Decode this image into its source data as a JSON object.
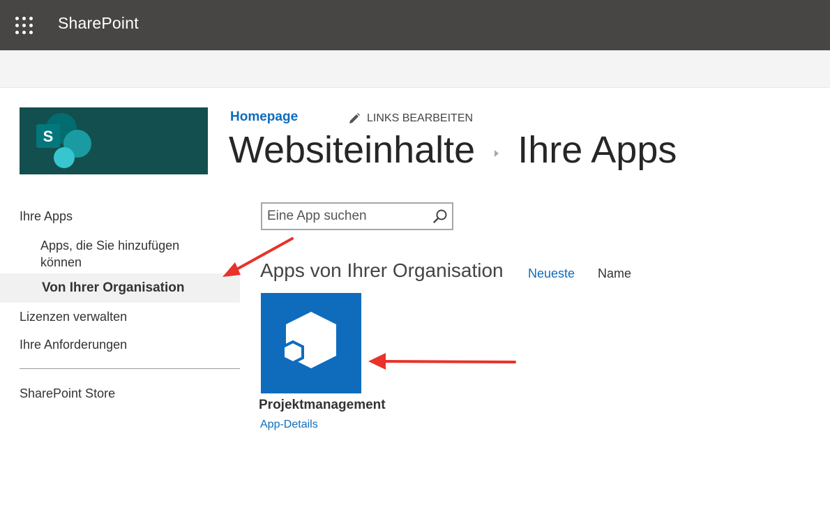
{
  "suitebar": {
    "app_title": "SharePoint",
    "launcher_icon": "app-launcher-icon",
    "background": "#484644"
  },
  "site": {
    "logo_letter": "S",
    "logo_icon": "sharepoint-logo-icon",
    "logo_background": "#134f4e"
  },
  "header": {
    "homepage_link": "Homepage",
    "edit_links_label": "LINKS BEARBEITEN",
    "edit_icon": "pencil-icon",
    "breadcrumb": [
      "Websiteinhalte",
      "Ihre Apps"
    ]
  },
  "leftnav": {
    "items": [
      {
        "label": "Ihre Apps"
      },
      {
        "label_line1": "Apps, die Sie hinzufügen",
        "label_line2": "können"
      },
      {
        "label": "Von Ihrer Organisation",
        "selected": true
      },
      {
        "label": "Lizenzen verwalten"
      },
      {
        "label": "Ihre Anforderungen"
      },
      {
        "label": "SharePoint Store"
      }
    ]
  },
  "search": {
    "placeholder": "Eine App suchen",
    "value": "",
    "icon": "search-icon"
  },
  "main": {
    "section_heading": "Apps von Ihrer Organisation",
    "sort_options": [
      {
        "label": "Neueste",
        "active": true
      },
      {
        "label": "Name",
        "active": false
      }
    ],
    "apps": [
      {
        "name": "Projektmanagement",
        "details_link": "App-Details",
        "icon": "app-cubes-icon",
        "tile_color": "#0f6cbd"
      }
    ]
  },
  "annotations": {
    "arrow_color": "#e8322a",
    "arrows": [
      "arrow-to-von-ihrer-organisation",
      "arrow-to-app-tile"
    ]
  }
}
